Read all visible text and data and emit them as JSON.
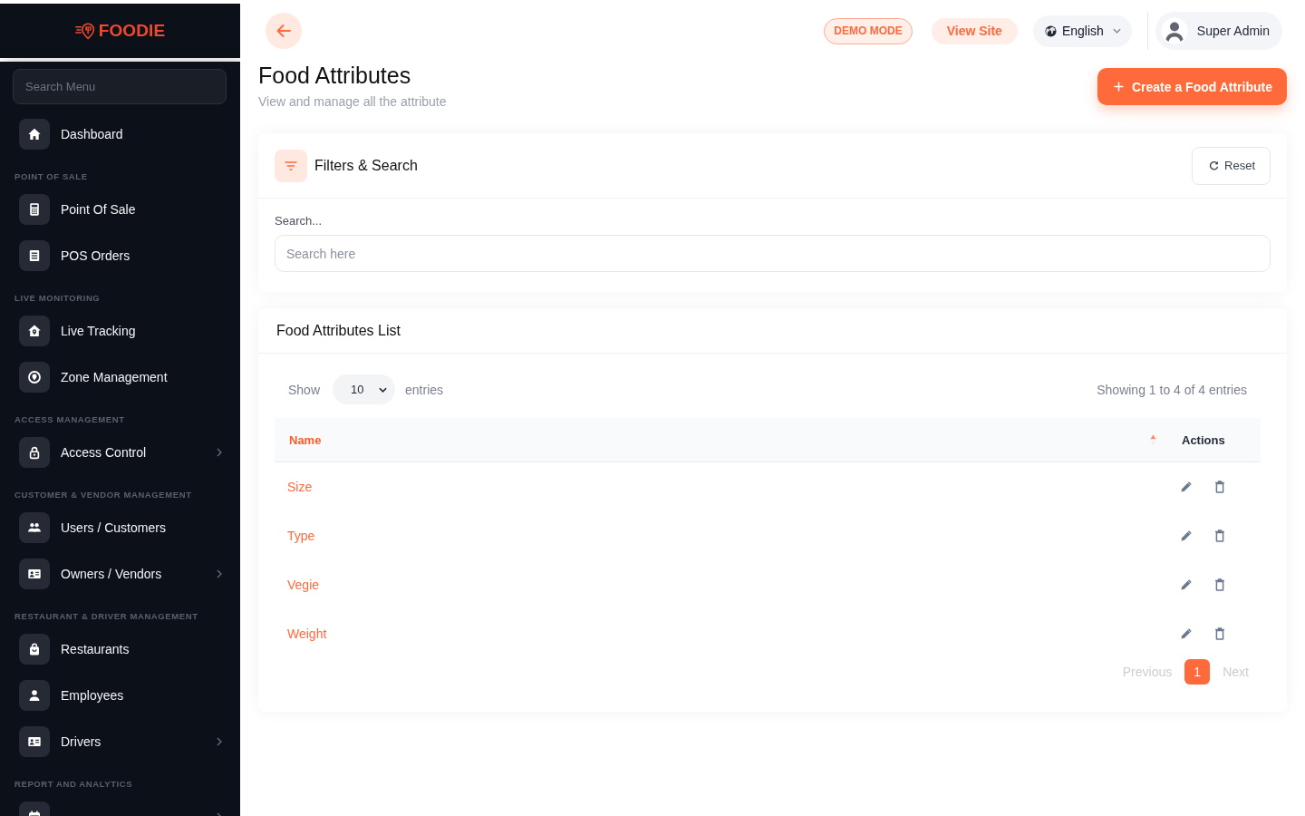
{
  "sidebar": {
    "logo": "FOODIE",
    "search_placeholder": "Search Menu",
    "sections": [
      {
        "items": [
          {
            "label": "Dashboard",
            "expandable": false
          }
        ]
      },
      {
        "title": "POINT OF SALE",
        "items": [
          {
            "label": "Point Of Sale",
            "expandable": false
          },
          {
            "label": "POS Orders",
            "expandable": false
          }
        ]
      },
      {
        "title": "LIVE MONITORING",
        "items": [
          {
            "label": "Live Tracking",
            "expandable": false
          },
          {
            "label": "Zone Management",
            "expandable": false
          }
        ]
      },
      {
        "title": "ACCESS MANAGEMENT",
        "items": [
          {
            "label": "Access Control",
            "expandable": true
          }
        ]
      },
      {
        "title": "CUSTOMER & VENDOR MANAGEMENT",
        "items": [
          {
            "label": "Users / Customers",
            "expandable": false
          },
          {
            "label": "Owners / Vendors",
            "expandable": true
          }
        ]
      },
      {
        "title": "RESTAURANT & DRIVER MANAGEMENT",
        "items": [
          {
            "label": "Restaurants",
            "expandable": false
          },
          {
            "label": "Employees",
            "expandable": false
          },
          {
            "label": "Drivers",
            "expandable": true
          }
        ]
      },
      {
        "title": "REPORT AND ANALYTICS",
        "items": [
          {
            "expandable": true
          }
        ]
      }
    ]
  },
  "topbar": {
    "demo_badge": "DEMO MODE",
    "view_site": "View Site",
    "language": "English",
    "user": "Super Admin"
  },
  "page": {
    "title": "Food Attributes",
    "subtitle": "View and manage all the attribute",
    "create_button": "Create a Food Attribute"
  },
  "filters": {
    "title": "Filters & Search",
    "reset": "Reset",
    "search_label": "Search...",
    "search_placeholder": "Search here"
  },
  "list": {
    "title": "Food Attributes List",
    "show_label": "Show",
    "page_size": "10",
    "entries_label": "entries",
    "summary": "Showing 1 to 4 of 4 entries",
    "columns": [
      {
        "label": "Name",
        "sorted": true,
        "ascending": true
      },
      {
        "label": "Actions",
        "sorted": false
      }
    ],
    "rows": [
      {
        "name": "Size"
      },
      {
        "name": "Type"
      },
      {
        "name": "Vegie"
      },
      {
        "name": "Weight"
      }
    ],
    "pagination": {
      "previous": "Previous",
      "previous_disabled": true,
      "pages": [
        {
          "label": "1",
          "selected": true
        }
      ],
      "next": "Next",
      "next_disabled": true
    }
  }
}
